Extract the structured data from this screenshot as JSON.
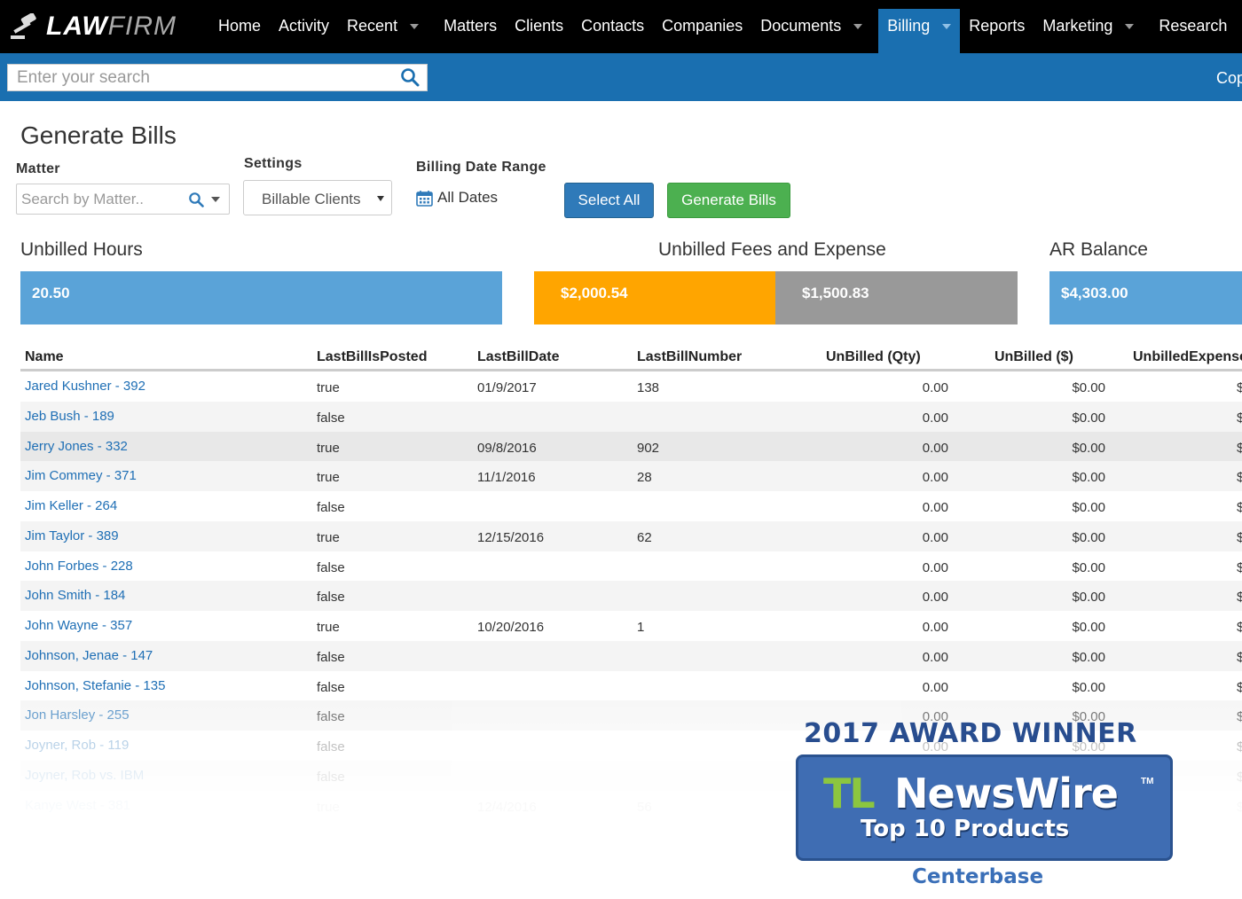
{
  "brand": {
    "logo_bold": "LAW",
    "logo_light": "FIRM"
  },
  "nav": {
    "items": [
      {
        "label": "Home",
        "dropdown": false
      },
      {
        "label": "Activity",
        "dropdown": false
      },
      {
        "label": "Recent",
        "dropdown": true
      },
      {
        "label": "Matters",
        "dropdown": false
      },
      {
        "label": "Clients",
        "dropdown": false
      },
      {
        "label": "Contacts",
        "dropdown": false
      },
      {
        "label": "Companies",
        "dropdown": false
      },
      {
        "label": "Documents",
        "dropdown": true
      },
      {
        "label": "Billing",
        "dropdown": true,
        "active": true
      },
      {
        "label": "Reports",
        "dropdown": false
      },
      {
        "label": "Marketing",
        "dropdown": true
      },
      {
        "label": "Research",
        "dropdown": false
      }
    ]
  },
  "search": {
    "placeholder": "Enter your search",
    "right_text": "Cop"
  },
  "page": {
    "title": "Generate Bills",
    "matter_label": "Matter",
    "matter_placeholder": "Search by Matter..",
    "settings_label": "Settings",
    "settings_value": "Billable Clients",
    "date_label": "Billing Date Range",
    "date_value": "All Dates",
    "select_all": "Select All",
    "generate": "Generate Bills"
  },
  "summary": {
    "hours_label": "Unbilled Hours",
    "hours_value": "20.50",
    "fees_label": "Unbilled Fees and Expense",
    "fees_value": "$2,000.54",
    "expense_value": "$1,500.83",
    "ar_label": "AR Balance",
    "ar_value": "$4,303.00"
  },
  "colors": {
    "nav_bg": "#000000",
    "accent_blue": "#1a6fb0",
    "hours_bar": "#5aa3d8",
    "fees_bar": "#ffa500",
    "expense_bar": "#999999",
    "ar_bar": "#5aa3d8",
    "link": "#1f6fb5",
    "green_button": "#4cb050"
  },
  "table": {
    "headers": [
      "Name",
      "LastBillIsPosted",
      "LastBillDate",
      "LastBillNumber",
      "UnBilled (Qty)",
      "UnBilled ($)",
      "UnbilledExpense"
    ],
    "rows": [
      [
        "Jared Kushner - 392",
        "true",
        "01/9/2017",
        "138",
        "0.00",
        "$0.00",
        "$"
      ],
      [
        "Jeb Bush - 189",
        "false",
        "",
        "",
        "0.00",
        "$0.00",
        "$"
      ],
      [
        "Jerry Jones - 332",
        "true",
        "09/8/2016",
        "902",
        "0.00",
        "$0.00",
        "$"
      ],
      [
        "Jim Commey - 371",
        "true",
        "11/1/2016",
        "28",
        "0.00",
        "$0.00",
        "$"
      ],
      [
        "Jim Keller - 264",
        "false",
        "",
        "",
        "0.00",
        "$0.00",
        "$"
      ],
      [
        "Jim Taylor - 389",
        "true",
        "12/15/2016",
        "62",
        "0.00",
        "$0.00",
        "$"
      ],
      [
        "John Forbes - 228",
        "false",
        "",
        "",
        "0.00",
        "$0.00",
        "$"
      ],
      [
        "John Smith - 184",
        "false",
        "",
        "",
        "0.00",
        "$0.00",
        "$"
      ],
      [
        "John Wayne - 357",
        "true",
        "10/20/2016",
        "1",
        "0.00",
        "$0.00",
        "$"
      ],
      [
        "Johnson, Jenae - 147",
        "false",
        "",
        "",
        "0.00",
        "$0.00",
        "$"
      ],
      [
        "Johnson, Stefanie - 135",
        "false",
        "",
        "",
        "0.00",
        "$0.00",
        "$"
      ],
      [
        "Jon Harsley - 255",
        "false",
        "",
        "",
        "0.00",
        "$0.00",
        "$"
      ],
      [
        "Joyner, Rob - 119",
        "false",
        "",
        "",
        "0.00",
        "$0.00",
        "$"
      ],
      [
        "Joyner, Rob vs. IBM",
        "false",
        "",
        "",
        "",
        "",
        "$"
      ],
      [
        "Kanye West - 381",
        "true",
        "12/4/2016",
        "56",
        "",
        "",
        "$"
      ]
    ]
  },
  "award": {
    "title": "2017 AWARD WINNER",
    "tl": "TL",
    "newswire": "NewsWire",
    "tm": "TM",
    "subtitle": "Top 10 Products",
    "company": "Centerbase"
  }
}
